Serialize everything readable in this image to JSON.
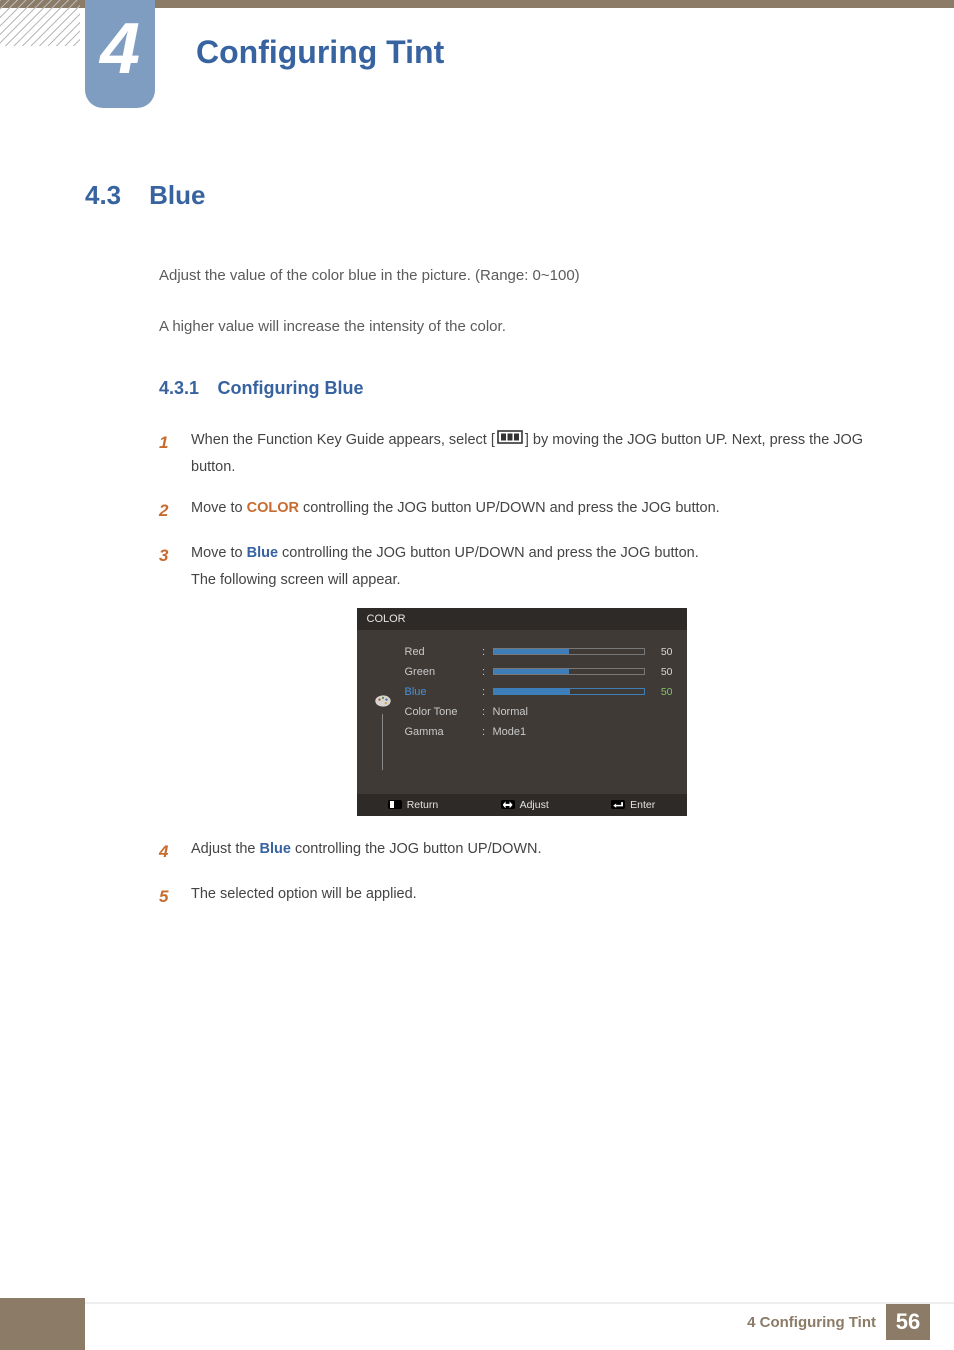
{
  "chapter": {
    "number": "4",
    "title": "Configuring Tint"
  },
  "section": {
    "number": "4.3",
    "title": "Blue"
  },
  "intro": {
    "line1": "Adjust the value of the color blue in the picture. (Range: 0~100)",
    "line2": "A higher value will increase the intensity of the color."
  },
  "subsection": {
    "number": "4.3.1",
    "title": "Configuring Blue"
  },
  "steps": {
    "s1": {
      "num": "1",
      "pre": "When the Function Key Guide appears, select  [",
      "post": "]  by moving the JOG button UP. Next, press the JOG button."
    },
    "s2": {
      "num": "2",
      "pre": "Move to ",
      "kw": "COLOR",
      "post": " controlling the JOG button UP/DOWN and press the JOG button."
    },
    "s3": {
      "num": "3",
      "pre": "Move to ",
      "kw": "Blue",
      "post": " controlling the JOG button UP/DOWN and press the JOG button.",
      "line2": "The following screen will appear."
    },
    "s4": {
      "num": "4",
      "pre": "Adjust the ",
      "kw": "Blue",
      "post": " controlling the JOG button UP/DOWN."
    },
    "s5": {
      "num": "5",
      "text": "The selected option will be applied."
    }
  },
  "osd": {
    "title": "COLOR",
    "rows": {
      "red": {
        "label": "Red",
        "value": "50",
        "fill_pct": 50
      },
      "green": {
        "label": "Green",
        "value": "50",
        "fill_pct": 50
      },
      "blue": {
        "label": "Blue",
        "value": "50",
        "fill_pct": 50,
        "selected": true
      },
      "tone": {
        "label": "Color Tone",
        "value": "Normal"
      },
      "gamma": {
        "label": "Gamma",
        "value": "Mode1"
      }
    },
    "footer": {
      "return": "Return",
      "adjust": "Adjust",
      "enter": "Enter"
    }
  },
  "footer": {
    "label": "4 Configuring Tint",
    "page": "56"
  }
}
